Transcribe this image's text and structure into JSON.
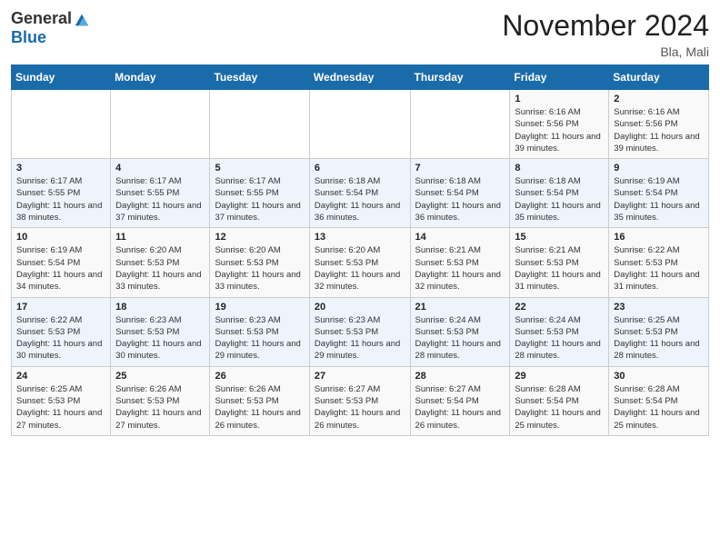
{
  "header": {
    "logo": {
      "general": "General",
      "blue": "Blue"
    },
    "title": "November 2024",
    "location": "Bla, Mali"
  },
  "days_of_week": [
    "Sunday",
    "Monday",
    "Tuesday",
    "Wednesday",
    "Thursday",
    "Friday",
    "Saturday"
  ],
  "weeks": [
    [
      {
        "day": "",
        "sunrise": "",
        "sunset": "",
        "daylight": ""
      },
      {
        "day": "",
        "sunrise": "",
        "sunset": "",
        "daylight": ""
      },
      {
        "day": "",
        "sunrise": "",
        "sunset": "",
        "daylight": ""
      },
      {
        "day": "",
        "sunrise": "",
        "sunset": "",
        "daylight": ""
      },
      {
        "day": "",
        "sunrise": "",
        "sunset": "",
        "daylight": ""
      },
      {
        "day": "1",
        "sunrise": "Sunrise: 6:16 AM",
        "sunset": "Sunset: 5:56 PM",
        "daylight": "Daylight: 11 hours and 39 minutes."
      },
      {
        "day": "2",
        "sunrise": "Sunrise: 6:16 AM",
        "sunset": "Sunset: 5:56 PM",
        "daylight": "Daylight: 11 hours and 39 minutes."
      }
    ],
    [
      {
        "day": "3",
        "sunrise": "Sunrise: 6:17 AM",
        "sunset": "Sunset: 5:55 PM",
        "daylight": "Daylight: 11 hours and 38 minutes."
      },
      {
        "day": "4",
        "sunrise": "Sunrise: 6:17 AM",
        "sunset": "Sunset: 5:55 PM",
        "daylight": "Daylight: 11 hours and 37 minutes."
      },
      {
        "day": "5",
        "sunrise": "Sunrise: 6:17 AM",
        "sunset": "Sunset: 5:55 PM",
        "daylight": "Daylight: 11 hours and 37 minutes."
      },
      {
        "day": "6",
        "sunrise": "Sunrise: 6:18 AM",
        "sunset": "Sunset: 5:54 PM",
        "daylight": "Daylight: 11 hours and 36 minutes."
      },
      {
        "day": "7",
        "sunrise": "Sunrise: 6:18 AM",
        "sunset": "Sunset: 5:54 PM",
        "daylight": "Daylight: 11 hours and 36 minutes."
      },
      {
        "day": "8",
        "sunrise": "Sunrise: 6:18 AM",
        "sunset": "Sunset: 5:54 PM",
        "daylight": "Daylight: 11 hours and 35 minutes."
      },
      {
        "day": "9",
        "sunrise": "Sunrise: 6:19 AM",
        "sunset": "Sunset: 5:54 PM",
        "daylight": "Daylight: 11 hours and 35 minutes."
      }
    ],
    [
      {
        "day": "10",
        "sunrise": "Sunrise: 6:19 AM",
        "sunset": "Sunset: 5:54 PM",
        "daylight": "Daylight: 11 hours and 34 minutes."
      },
      {
        "day": "11",
        "sunrise": "Sunrise: 6:20 AM",
        "sunset": "Sunset: 5:53 PM",
        "daylight": "Daylight: 11 hours and 33 minutes."
      },
      {
        "day": "12",
        "sunrise": "Sunrise: 6:20 AM",
        "sunset": "Sunset: 5:53 PM",
        "daylight": "Daylight: 11 hours and 33 minutes."
      },
      {
        "day": "13",
        "sunrise": "Sunrise: 6:20 AM",
        "sunset": "Sunset: 5:53 PM",
        "daylight": "Daylight: 11 hours and 32 minutes."
      },
      {
        "day": "14",
        "sunrise": "Sunrise: 6:21 AM",
        "sunset": "Sunset: 5:53 PM",
        "daylight": "Daylight: 11 hours and 32 minutes."
      },
      {
        "day": "15",
        "sunrise": "Sunrise: 6:21 AM",
        "sunset": "Sunset: 5:53 PM",
        "daylight": "Daylight: 11 hours and 31 minutes."
      },
      {
        "day": "16",
        "sunrise": "Sunrise: 6:22 AM",
        "sunset": "Sunset: 5:53 PM",
        "daylight": "Daylight: 11 hours and 31 minutes."
      }
    ],
    [
      {
        "day": "17",
        "sunrise": "Sunrise: 6:22 AM",
        "sunset": "Sunset: 5:53 PM",
        "daylight": "Daylight: 11 hours and 30 minutes."
      },
      {
        "day": "18",
        "sunrise": "Sunrise: 6:23 AM",
        "sunset": "Sunset: 5:53 PM",
        "daylight": "Daylight: 11 hours and 30 minutes."
      },
      {
        "day": "19",
        "sunrise": "Sunrise: 6:23 AM",
        "sunset": "Sunset: 5:53 PM",
        "daylight": "Daylight: 11 hours and 29 minutes."
      },
      {
        "day": "20",
        "sunrise": "Sunrise: 6:23 AM",
        "sunset": "Sunset: 5:53 PM",
        "daylight": "Daylight: 11 hours and 29 minutes."
      },
      {
        "day": "21",
        "sunrise": "Sunrise: 6:24 AM",
        "sunset": "Sunset: 5:53 PM",
        "daylight": "Daylight: 11 hours and 28 minutes."
      },
      {
        "day": "22",
        "sunrise": "Sunrise: 6:24 AM",
        "sunset": "Sunset: 5:53 PM",
        "daylight": "Daylight: 11 hours and 28 minutes."
      },
      {
        "day": "23",
        "sunrise": "Sunrise: 6:25 AM",
        "sunset": "Sunset: 5:53 PM",
        "daylight": "Daylight: 11 hours and 28 minutes."
      }
    ],
    [
      {
        "day": "24",
        "sunrise": "Sunrise: 6:25 AM",
        "sunset": "Sunset: 5:53 PM",
        "daylight": "Daylight: 11 hours and 27 minutes."
      },
      {
        "day": "25",
        "sunrise": "Sunrise: 6:26 AM",
        "sunset": "Sunset: 5:53 PM",
        "daylight": "Daylight: 11 hours and 27 minutes."
      },
      {
        "day": "26",
        "sunrise": "Sunrise: 6:26 AM",
        "sunset": "Sunset: 5:53 PM",
        "daylight": "Daylight: 11 hours and 26 minutes."
      },
      {
        "day": "27",
        "sunrise": "Sunrise: 6:27 AM",
        "sunset": "Sunset: 5:53 PM",
        "daylight": "Daylight: 11 hours and 26 minutes."
      },
      {
        "day": "28",
        "sunrise": "Sunrise: 6:27 AM",
        "sunset": "Sunset: 5:54 PM",
        "daylight": "Daylight: 11 hours and 26 minutes."
      },
      {
        "day": "29",
        "sunrise": "Sunrise: 6:28 AM",
        "sunset": "Sunset: 5:54 PM",
        "daylight": "Daylight: 11 hours and 25 minutes."
      },
      {
        "day": "30",
        "sunrise": "Sunrise: 6:28 AM",
        "sunset": "Sunset: 5:54 PM",
        "daylight": "Daylight: 11 hours and 25 minutes."
      }
    ]
  ]
}
